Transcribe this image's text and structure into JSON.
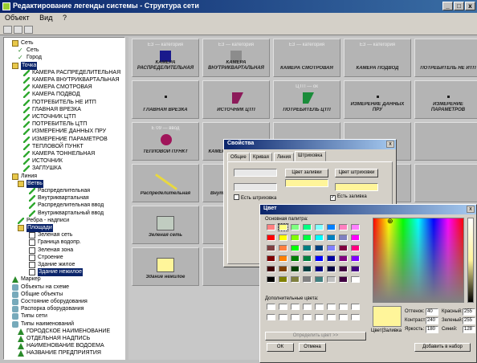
{
  "window": {
    "title": "Редактирование легенды системы - Структура сети",
    "controls": {
      "min": "_",
      "max": "□",
      "close": "x"
    }
  },
  "menubar": [
    "Объект",
    "Вид",
    "?"
  ],
  "tree": [
    {
      "label": "Сеть",
      "icon": "folder-icon",
      "depth": 1
    },
    {
      "label": "Сеть",
      "icon": "check-icon",
      "depth": 2
    },
    {
      "label": "Город",
      "icon": "check-icon",
      "depth": 2
    },
    {
      "label": "Точка",
      "icon": "folder-icon",
      "depth": 1,
      "selected": true
    },
    {
      "label": "КАМЕРА РАСПРЕДЕЛИТЕЛЬНАЯ",
      "icon": "pen-icon",
      "depth": 3
    },
    {
      "label": "КАМЕРА ВНУТРИКВАРТАЛЬНАЯ",
      "icon": "pen-icon",
      "depth": 3
    },
    {
      "label": "КАМЕРА СМОТРОВАЯ",
      "icon": "pen-icon",
      "depth": 3
    },
    {
      "label": "КАМЕРА ПОДВОД",
      "icon": "pen-icon",
      "depth": 3
    },
    {
      "label": "ПОТРЕБИТЕЛЬ НЕ ИТП",
      "icon": "pen-icon",
      "depth": 3
    },
    {
      "label": "ГЛАВНАЯ ВРЕЗКА",
      "icon": "pen-icon",
      "depth": 3
    },
    {
      "label": "ИСТОЧНИК ЦТП",
      "icon": "pen-icon",
      "depth": 3
    },
    {
      "label": "ПОТРЕБИТЕЛЬ ЦТП",
      "icon": "pen-icon",
      "depth": 3
    },
    {
      "label": "ИЗМЕРЕНИЕ ДАННЫХ ПРУ",
      "icon": "pen-icon",
      "depth": 3
    },
    {
      "label": "ИЗМЕРЕНИЕ ПАРАМЕТРОВ",
      "icon": "pen-icon",
      "depth": 3
    },
    {
      "label": "ТЕПЛОВОЙ ПУНКТ",
      "icon": "pen-icon",
      "depth": 3
    },
    {
      "label": "КАМЕРА ТОННЕЛЬНАЯ",
      "icon": "pen-icon",
      "depth": 3
    },
    {
      "label": "ИСТОЧНИК",
      "icon": "pen-icon",
      "depth": 3
    },
    {
      "label": "ЗАГЛУШКА",
      "icon": "pen-icon",
      "depth": 3
    },
    {
      "label": "Линия",
      "icon": "folder-icon",
      "depth": 1
    },
    {
      "label": "Ветвь",
      "icon": "folder-icon",
      "depth": 2,
      "selected": true
    },
    {
      "label": "Распределительная",
      "icon": "pen-icon",
      "depth": 4
    },
    {
      "label": "Внутриквартальная",
      "icon": "pen-icon",
      "depth": 4
    },
    {
      "label": "Распределительная ввод",
      "icon": "pen-icon",
      "depth": 4
    },
    {
      "label": "Внутриквартальный ввод",
      "icon": "pen-icon",
      "depth": 4
    },
    {
      "label": "Ребра - надписи",
      "icon": "pen-icon",
      "depth": 2
    },
    {
      "label": "Площади",
      "icon": "folder-icon",
      "depth": 2,
      "selected": true
    },
    {
      "label": "Зеленая сеть",
      "icon": "box-icon",
      "depth": 4
    },
    {
      "label": "Граница водопр.",
      "icon": "box-icon",
      "depth": 4
    },
    {
      "label": "Зеленая зона",
      "icon": "box-icon",
      "depth": 4
    },
    {
      "label": "Строение",
      "icon": "box-icon",
      "depth": 4
    },
    {
      "label": "Здание жилое",
      "icon": "box-icon",
      "depth": 4
    },
    {
      "label": "Здание нежилое",
      "icon": "box-icon",
      "depth": 4,
      "selected": true
    },
    {
      "label": "Маркер",
      "icon": "triangle-icon",
      "depth": 1
    },
    {
      "label": "Объекты на схеме",
      "icon": "gear-icon",
      "depth": 1
    },
    {
      "label": "Общие объекты",
      "icon": "gear-icon",
      "depth": 1
    },
    {
      "label": "Состояние оборудования",
      "icon": "gear-icon",
      "depth": 1
    },
    {
      "label": "Распорка оборудования",
      "icon": "gear-icon",
      "depth": 1
    },
    {
      "label": "Типы сети",
      "icon": "gear-icon",
      "depth": 1
    },
    {
      "label": "Типы наименований",
      "icon": "gear-icon",
      "depth": 1
    },
    {
      "label": "ГОРОДСКОЕ НАИМЕНОВАНИЕ",
      "icon": "triangle-icon",
      "depth": 2
    },
    {
      "label": "ОТДЕЛЬНАЯ НАДПИСЬ",
      "icon": "triangle-icon",
      "depth": 2
    },
    {
      "label": "НАИМЕНОВАНИЕ ВОДОЕМА",
      "icon": "triangle-icon",
      "depth": 2
    },
    {
      "label": "НАЗВАНИЕ ПРЕДПРИЯТИЯ",
      "icon": "triangle-icon",
      "depth": 2
    }
  ],
  "palette": [
    {
      "header": "ЕЗ — категория",
      "label": "КАМЕРА РАСПРЕДЕЛИТЕЛЬНАЯ",
      "symbol": "square",
      "color": "#1a1a8c"
    },
    {
      "header": "ЕЗ — категория",
      "label": "КАМЕРА ВНУТРИКВАРТАЛЬНАЯ",
      "symbol": "square",
      "color": "#8c8c8c"
    },
    {
      "header": "ЕЗ — категория",
      "label": "КАМЕРА СМОТРОВАЯ",
      "symbol": "none",
      "color": ""
    },
    {
      "header": "ЕЗ — категория",
      "label": "КАМЕРА ПОДВОД",
      "symbol": "none",
      "color": ""
    },
    {
      "header": "",
      "label": "ПОТРЕБИТЕЛЬ НЕ ИТП",
      "symbol": "none",
      "color": ""
    },
    {
      "header": "",
      "label": "ГЛАВНАЯ ВРЕЗКА",
      "symbol": "dot",
      "color": "#202020"
    },
    {
      "header": "",
      "label": "ИСТОЧНИК ЦТП",
      "symbol": "triangle",
      "color": "#8c1a5a"
    },
    {
      "header": "ЦТП — ок",
      "label": "ПОТРЕБИТЕЛЬ ЦТП",
      "symbol": "triangle",
      "color": "#1a8c3a"
    },
    {
      "header": "",
      "label": "ИЗМЕРЕНИЕ ДАННЫХ ПРУ",
      "symbol": "dot",
      "color": "#202020"
    },
    {
      "header": "",
      "label": "ИЗМЕРЕНИЕ ПАРАМЕТРОВ",
      "symbol": "dot",
      "color": "#202020"
    },
    {
      "header": "Е 09 — ввод",
      "label": "ТЕПЛОВОЙ ПУНКТ",
      "symbol": "circle",
      "color": "#a0145a"
    },
    {
      "header": "",
      "label": "КАМЕРА ТОННЕЛЬНАЯ",
      "symbol": "none",
      "color": ""
    },
    {
      "header": "",
      "label": "",
      "symbol": "none",
      "color": ""
    },
    {
      "header": "",
      "label": "",
      "symbol": "none",
      "color": ""
    },
    {
      "header": "",
      "label": "",
      "symbol": "none",
      "color": ""
    },
    {
      "header": "",
      "label": "Распределительная",
      "symbol": "line",
      "color": "#e8d840"
    },
    {
      "header": "",
      "label": "Внутриквартальная",
      "symbol": "none",
      "color": ""
    },
    {
      "header": "",
      "label": "",
      "symbol": "none",
      "color": ""
    },
    {
      "header": "",
      "label": "",
      "symbol": "none",
      "color": ""
    },
    {
      "header": "",
      "label": "",
      "symbol": "none",
      "color": ""
    },
    {
      "header": "",
      "label": "Зеленая сеть",
      "symbol": "rect",
      "color": "#c0ccc0"
    },
    {
      "header": "",
      "label": "Граница",
      "symbol": "none",
      "color": ""
    },
    {
      "header": "",
      "label": "",
      "symbol": "none",
      "color": ""
    },
    {
      "header": "",
      "label": "",
      "symbol": "none",
      "color": ""
    },
    {
      "header": "",
      "label": "",
      "symbol": "none",
      "color": ""
    },
    {
      "header": "",
      "label": "Здание нежилое",
      "symbol": "rect",
      "color": "#fff59a"
    },
    {
      "header": "",
      "label": "",
      "symbol": "none",
      "color": ""
    },
    {
      "header": "",
      "label": "",
      "symbol": "none",
      "color": ""
    },
    {
      "header": "",
      "label": "",
      "symbol": "none",
      "color": ""
    },
    {
      "header": "",
      "label": "",
      "symbol": "none",
      "color": ""
    }
  ],
  "property_dialog": {
    "title": "Свойства",
    "close": "x",
    "tabs": [
      "Общие",
      "Кривая",
      "Линия",
      "Штриховка"
    ],
    "fill_color_label": "Цвет штриховки",
    "pen_color_label": "Цвет заливки",
    "cb_transparent": "Есть штриховка",
    "cb_fill": "Есть заливка",
    "fill_swatch": "#fff59a"
  },
  "color_dialog": {
    "title": "Цвет",
    "basic_label": "Основная палитра:",
    "custom_label": "Дополнительные цвета:",
    "define_button": "Определить цвет >>",
    "ok_button": "ОК",
    "cancel_button": "Отмена",
    "add_button": "Добавить в набор",
    "preview_label": "Цвет|Заливка",
    "preview_color": "#fff59a",
    "fields": [
      {
        "label": "Оттенок:",
        "value": "40"
      },
      {
        "label": "Контраст:",
        "value": "240"
      },
      {
        "label": "Яркость:",
        "value": "180"
      },
      {
        "label": "Красный:",
        "value": "255"
      },
      {
        "label": "Зеленый:",
        "value": "255"
      },
      {
        "label": "Синий:",
        "value": "128"
      }
    ],
    "basic_colors": [
      "#ff8080",
      "#ffff80",
      "#80ff80",
      "#00ff80",
      "#80ffff",
      "#0080ff",
      "#ff80c0",
      "#ff80ff",
      "#ff0000",
      "#ffff00",
      "#80ff00",
      "#00ff40",
      "#00ffff",
      "#0080c0",
      "#8080c0",
      "#ff00ff",
      "#804040",
      "#ff8040",
      "#00ff00",
      "#008080",
      "#004080",
      "#8080ff",
      "#800040",
      "#ff0080",
      "#800000",
      "#ff8000",
      "#008000",
      "#008040",
      "#0000ff",
      "#0000a0",
      "#800080",
      "#8000ff",
      "#400000",
      "#804000",
      "#004000",
      "#004040",
      "#000080",
      "#000040",
      "#400040",
      "#400080",
      "#000000",
      "#808000",
      "#808040",
      "#808080",
      "#408080",
      "#c0c0c0",
      "#400040",
      "#ffffff"
    ]
  }
}
